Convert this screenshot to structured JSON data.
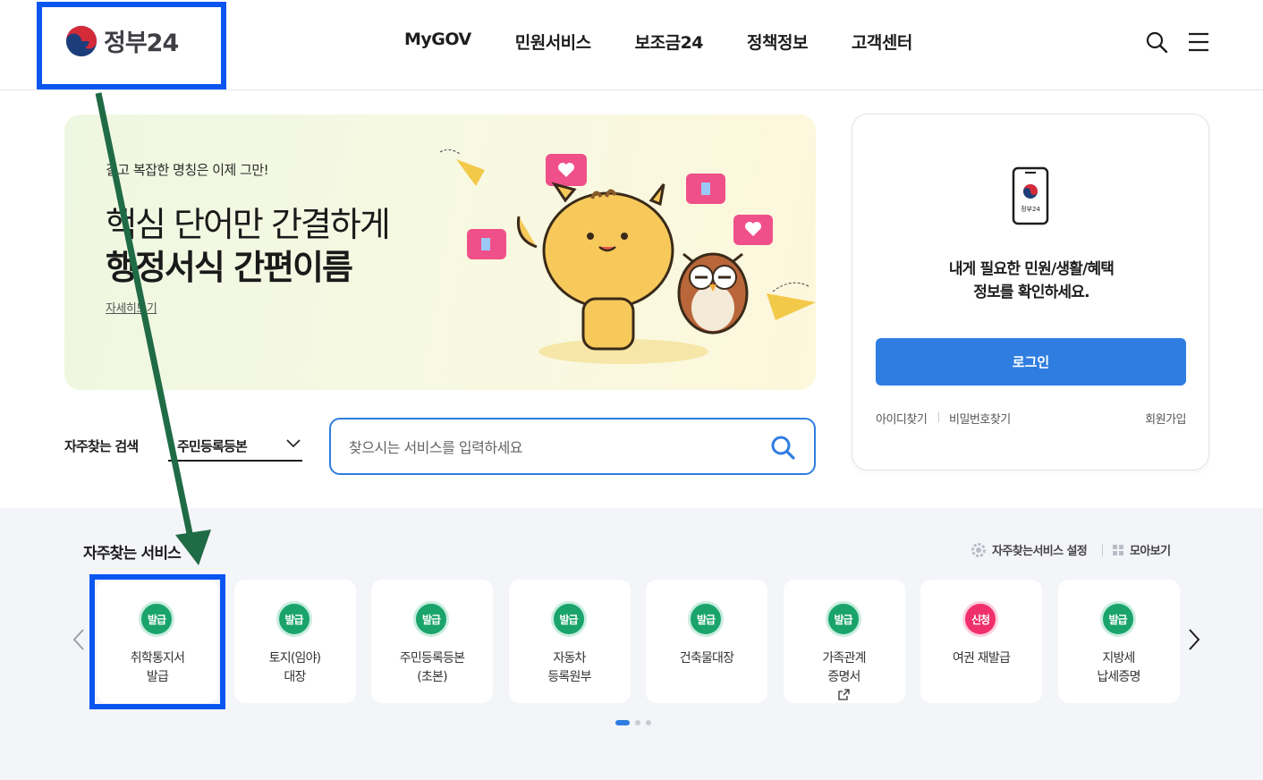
{
  "header": {
    "logo_text": "정부24",
    "nav": [
      "MyGOV",
      "민원서비스",
      "보조금24",
      "정책정보",
      "고객센터"
    ],
    "search_icon": "search-icon",
    "menu_icon": "hamburger-menu-icon"
  },
  "banner": {
    "eyebrow": "길고 복잡한 명칭은 이제 그만!",
    "line1": "핵심 단어만 간결하게",
    "line2": "행정서식 간편이름",
    "more": "자세히보기"
  },
  "login": {
    "phone_label": "정부24",
    "message_line1": "내게 필요한 민원/생활/혜택",
    "message_line2": "정보를 확인하세요.",
    "button": "로그인",
    "find_id": "아이디찾기",
    "find_pw": "비밀번호찾기",
    "join": "회원가입"
  },
  "search": {
    "frequent_label": "자주찾는 검색",
    "frequent_selected": "주민등록등본",
    "placeholder": "찾으시는 서비스를 입력하세요"
  },
  "services": {
    "title": "자주찾는 서비스",
    "setting": "자주찾는서비스 설정",
    "view_all": "모아보기",
    "items": [
      {
        "badge": "발급",
        "line1": "취학통지서",
        "line2": "발급"
      },
      {
        "badge": "발급",
        "line1": "토지(임야)",
        "line2": "대장"
      },
      {
        "badge": "발급",
        "line1": "주민등록등본",
        "line2": "(초본)"
      },
      {
        "badge": "발급",
        "line1": "자동차",
        "line2": "등록원부"
      },
      {
        "badge": "발급",
        "line1": "건축물대장",
        "line2": ""
      },
      {
        "badge": "발급",
        "line1": "가족관계",
        "line2": "증명서"
      },
      {
        "badge": "신청",
        "line1": "여권 재발급",
        "line2": ""
      },
      {
        "badge": "발급",
        "line1": "지방세",
        "line2": "납세증명"
      }
    ],
    "page_count": 3,
    "current_page": 1
  },
  "colors": {
    "primary": "#2f7de1",
    "badge_issue": "#1aa46b",
    "badge_apply": "#f0306c",
    "annotation_box": "#0a55f0",
    "annotation_arrow": "#1f6b45"
  }
}
